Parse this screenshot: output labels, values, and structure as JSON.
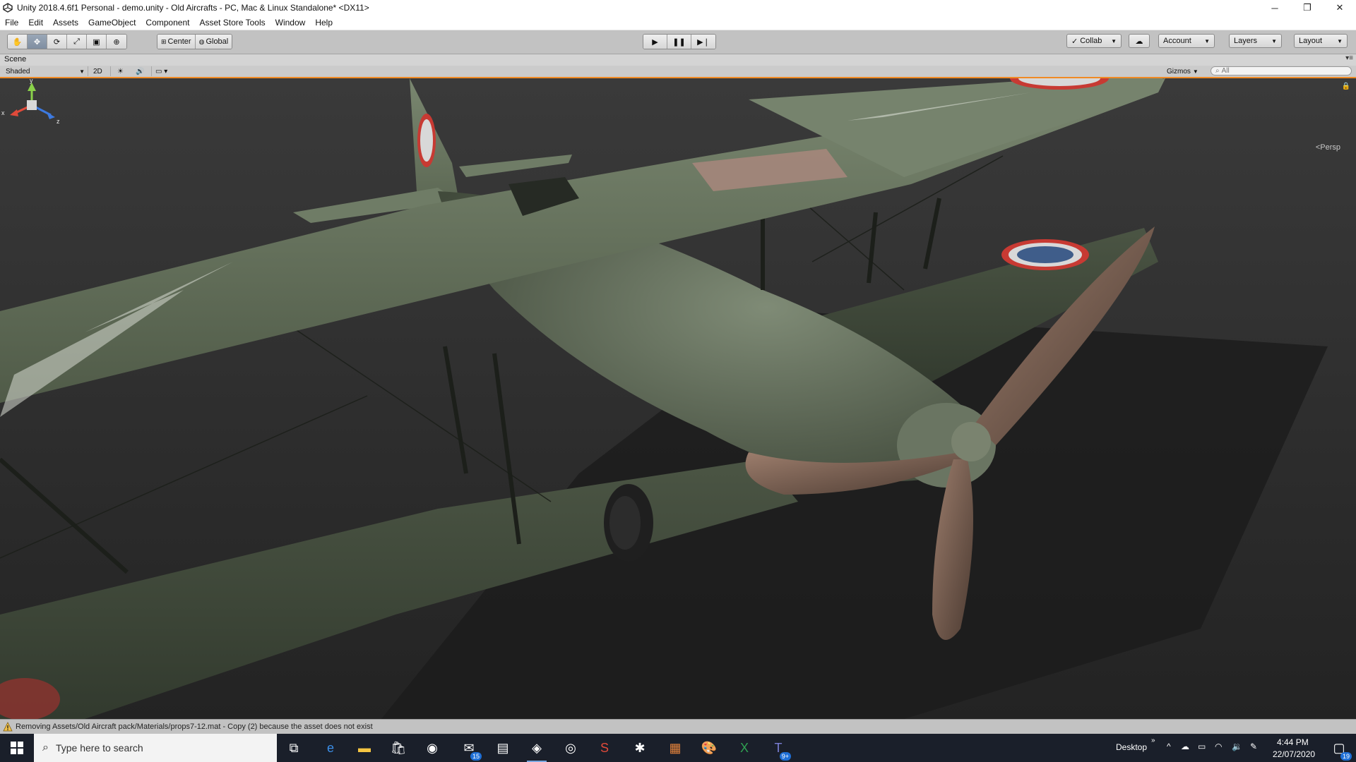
{
  "window": {
    "title": "Unity 2018.4.6f1 Personal - demo.unity - Old Aircrafts - PC, Mac & Linux Standalone* <DX11>",
    "controls": {
      "minimize": "─",
      "maximize": "❐",
      "close": "✕"
    }
  },
  "menu": [
    "File",
    "Edit",
    "Assets",
    "GameObject",
    "Component",
    "Asset Store Tools",
    "Window",
    "Help"
  ],
  "toolbar": {
    "pivot_label": "Center",
    "space_label": "Global",
    "collab_label": "Collab",
    "account_label": "Account",
    "layers_label": "Layers",
    "layout_label": "Layout"
  },
  "scene": {
    "tab_label": "Scene",
    "shading_mode": "Shaded",
    "mode_2d": "2D",
    "gizmos_label": "Gizmos",
    "search_placeholder": "All",
    "projection_label": "Persp",
    "axis_y": "y",
    "axis_x": "x",
    "axis_z": "z"
  },
  "status": {
    "message": "Removing Assets/Old Aircraft pack/Materials/props7-12.mat - Copy (2) because the asset does not exist"
  },
  "taskbar": {
    "search_placeholder": "Type here to search",
    "mail_badge": "15",
    "teams_badge": "9+",
    "desktop_label": "Desktop",
    "time": "4:44 PM",
    "date": "22/07/2020",
    "notifications_count": "19"
  },
  "colors": {
    "accent_orange": "#f08a24",
    "viewport_bg": "#2b2b2b",
    "plane_green": "#5f6c55",
    "taskbar_bg": "#1a1f2a"
  }
}
